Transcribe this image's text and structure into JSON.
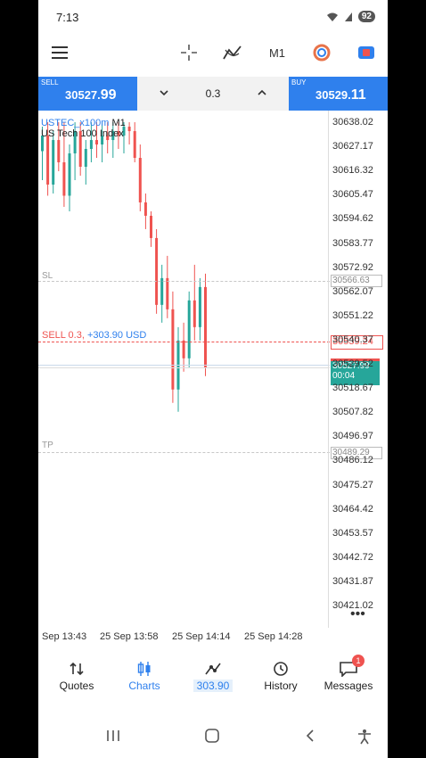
{
  "status": {
    "time": "7:13",
    "battery": "92"
  },
  "toolbar": {
    "timeframe": "M1"
  },
  "trade": {
    "sell_label": "SELL",
    "sell_price_main": "30527.",
    "sell_price_sup": "99",
    "buy_label": "BUY",
    "buy_price_main": "30529.",
    "buy_price_sup": "11",
    "volume": "0.3"
  },
  "chart": {
    "symbol": "USTEC_x100m",
    "timeframe": "M1",
    "description": "US Tech 100 Index",
    "sl_label": "SL",
    "tp_label": "TP",
    "position_label": "SELL 0.3,",
    "position_profit": "+303.90 USD",
    "sl_price": "30566.63",
    "position_price": "30539.24",
    "current_price": "30527.99",
    "countdown": "00:04",
    "tp_price": "30489.29",
    "ticks": [
      "30638.02",
      "30627.17",
      "30616.32",
      "30605.47",
      "30594.62",
      "30583.77",
      "30572.92",
      "30562.07",
      "30551.22",
      "30540.37",
      "30529.52",
      "30518.67",
      "30507.82",
      "30496.97",
      "30486.12",
      "30475.27",
      "30464.42",
      "30453.57",
      "30442.72",
      "30431.87",
      "30421.02"
    ],
    "x_labels": [
      "Sep 13:43",
      "25 Sep 13:58",
      "25 Sep 14:14",
      "25 Sep 14:28"
    ],
    "colors": {
      "bull": "#26a69a",
      "bear": "#ef5350",
      "accent": "#2f80ed"
    }
  },
  "chart_data": {
    "type": "candlestick",
    "ylim": [
      30421.02,
      30638.02
    ],
    "candles": [
      {
        "o": 30625,
        "h": 30636,
        "l": 30612,
        "c": 30632
      },
      {
        "o": 30632,
        "h": 30638,
        "l": 30605,
        "c": 30610
      },
      {
        "o": 30610,
        "h": 30634,
        "l": 30606,
        "c": 30630
      },
      {
        "o": 30630,
        "h": 30638,
        "l": 30616,
        "c": 30620
      },
      {
        "o": 30620,
        "h": 30638,
        "l": 30600,
        "c": 30605
      },
      {
        "o": 30605,
        "h": 30628,
        "l": 30598,
        "c": 30624
      },
      {
        "o": 30624,
        "h": 30638,
        "l": 30612,
        "c": 30634
      },
      {
        "o": 30634,
        "h": 30638,
        "l": 30614,
        "c": 30618
      },
      {
        "o": 30618,
        "h": 30630,
        "l": 30610,
        "c": 30626
      },
      {
        "o": 30626,
        "h": 30638,
        "l": 30620,
        "c": 30630
      },
      {
        "o": 30630,
        "h": 30638,
        "l": 30622,
        "c": 30628
      },
      {
        "o": 30628,
        "h": 30638,
        "l": 30620,
        "c": 30632
      },
      {
        "o": 30632,
        "h": 30638,
        "l": 30624,
        "c": 30630
      },
      {
        "o": 30630,
        "h": 30638,
        "l": 30622,
        "c": 30634
      },
      {
        "o": 30634,
        "h": 30638,
        "l": 30626,
        "c": 30632
      },
      {
        "o": 30632,
        "h": 30638,
        "l": 30624,
        "c": 30636
      },
      {
        "o": 30636,
        "h": 30638,
        "l": 30628,
        "c": 30634
      },
      {
        "o": 30634,
        "h": 30638,
        "l": 30620,
        "c": 30622
      },
      {
        "o": 30622,
        "h": 30628,
        "l": 30598,
        "c": 30602
      },
      {
        "o": 30602,
        "h": 30606,
        "l": 30590,
        "c": 30596
      },
      {
        "o": 30596,
        "h": 30598,
        "l": 30582,
        "c": 30586
      },
      {
        "o": 30586,
        "h": 30590,
        "l": 30552,
        "c": 30556
      },
      {
        "o": 30556,
        "h": 30574,
        "l": 30548,
        "c": 30568
      },
      {
        "o": 30568,
        "h": 30578,
        "l": 30550,
        "c": 30554
      },
      {
        "o": 30554,
        "h": 30562,
        "l": 30512,
        "c": 30518
      },
      {
        "o": 30518,
        "h": 30546,
        "l": 30508,
        "c": 30540
      },
      {
        "o": 30540,
        "h": 30548,
        "l": 30526,
        "c": 30532
      },
      {
        "o": 30532,
        "h": 30562,
        "l": 30528,
        "c": 30558
      },
      {
        "o": 30558,
        "h": 30574,
        "l": 30540,
        "c": 30546
      },
      {
        "o": 30546,
        "h": 30568,
        "l": 30540,
        "c": 30564
      },
      {
        "o": 30564,
        "h": 30570,
        "l": 30524,
        "c": 30528
      }
    ]
  },
  "nav": {
    "quotes": "Quotes",
    "charts": "Charts",
    "trade": "303.90",
    "history": "History",
    "messages": "Messages",
    "messages_badge": "1"
  }
}
